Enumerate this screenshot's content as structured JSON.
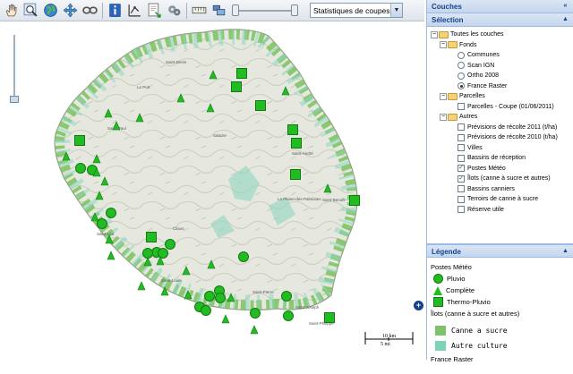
{
  "toolbar": {
    "stats_select_value": "Statistiques de coupes",
    "icons": [
      "hand-pan-icon",
      "zoom-icon",
      "globe-icon",
      "move-icon",
      "link-icon",
      "info-icon",
      "measure-icon",
      "export-icon",
      "settings-icon",
      "ruler-icon",
      "layers-icon"
    ]
  },
  "panel": {
    "couches_title": "Couches",
    "selection_title": "Sélection",
    "legend_title": "Légende",
    "tree": {
      "root": "Toutes les couches",
      "fonds": "Fonds",
      "fonds_items": [
        "Communes",
        "Scan IGN",
        "Ortho 2008",
        "France Raster"
      ],
      "fonds_selected": 3,
      "parcelles": "Parcelles",
      "parcelles_items": [
        "Parcelles - Coupe (01/06/2011)"
      ],
      "autres": "Autres",
      "autres_items": [
        "Prévisions de récolte 2011 (t/ha)",
        "Prévisions de récolte 2010 (t/ha)",
        "Villes",
        "Bassins de réception",
        "Postes Météo",
        "Îlots (canne à sucre et autres)",
        "Bassins canniers",
        "Terroirs de canne à sucre",
        "Réserve utile"
      ],
      "autres_checked": [
        4,
        5
      ]
    },
    "legend": {
      "postes_title": "Postes Météo",
      "pluvio": "Pluvio",
      "complete": "Complète",
      "thermo": "Thermo-Pluvio",
      "ilots_title": "Îlots (canne à sucre et autres)",
      "canne": "Canne a sucre",
      "autre": "Autre culture",
      "raster": "France Raster",
      "colors": {
        "station": "#22bb22",
        "canne": "#7ec36a",
        "autre": "#7fd1b9"
      }
    }
  },
  "map": {
    "scale_km": "10 km",
    "scale_mi": "5 mi",
    "places": [
      "Saint-Denis",
      "Le Port",
      "Saint-Paul",
      "Saint-Leu",
      "Saint-Louis",
      "Saint-Pierre",
      "Saint-Joseph",
      "Saint-André",
      "Saint-Benoît",
      "Salazie",
      "Cilaos",
      "La Plaine-des-Palmistes",
      "Saint-Philippe"
    ],
    "stations": {
      "circles": [
        [
          90,
          188
        ],
        [
          103,
          190
        ],
        [
          124,
          238
        ],
        [
          114,
          250
        ],
        [
          190,
          273
        ],
        [
          175,
          282
        ],
        [
          165,
          283
        ],
        [
          223,
          343
        ],
        [
          234,
          331
        ],
        [
          245,
          325
        ],
        [
          230,
          347
        ],
        [
          285,
          350
        ],
        [
          320,
          331
        ],
        [
          322,
          353
        ],
        [
          182,
          283
        ],
        [
          246,
          333
        ],
        [
          272,
          287
        ]
      ],
      "triangles": [
        [
          238,
          84
        ],
        [
          235,
          121
        ],
        [
          202,
          110
        ],
        [
          121,
          127
        ],
        [
          130,
          141
        ],
        [
          156,
          132
        ],
        [
          74,
          175
        ],
        [
          108,
          178
        ],
        [
          117,
          203
        ],
        [
          111,
          219
        ],
        [
          106,
          243
        ],
        [
          122,
          268
        ],
        [
          124,
          286
        ],
        [
          165,
          293
        ],
        [
          179,
          292
        ],
        [
          208,
          303
        ],
        [
          236,
          296
        ],
        [
          210,
          330
        ],
        [
          258,
          333
        ],
        [
          252,
          357
        ],
        [
          284,
          369
        ],
        [
          366,
          211
        ],
        [
          184,
          326
        ],
        [
          158,
          320
        ],
        [
          319,
          102
        ],
        [
          108,
          193
        ]
      ],
      "squares": [
        [
          270,
          82
        ],
        [
          264,
          97
        ],
        [
          291,
          118
        ],
        [
          327,
          145
        ],
        [
          331,
          160
        ],
        [
          330,
          195
        ],
        [
          396,
          224
        ],
        [
          368,
          355
        ],
        [
          89,
          157
        ],
        [
          169,
          265
        ]
      ]
    }
  }
}
